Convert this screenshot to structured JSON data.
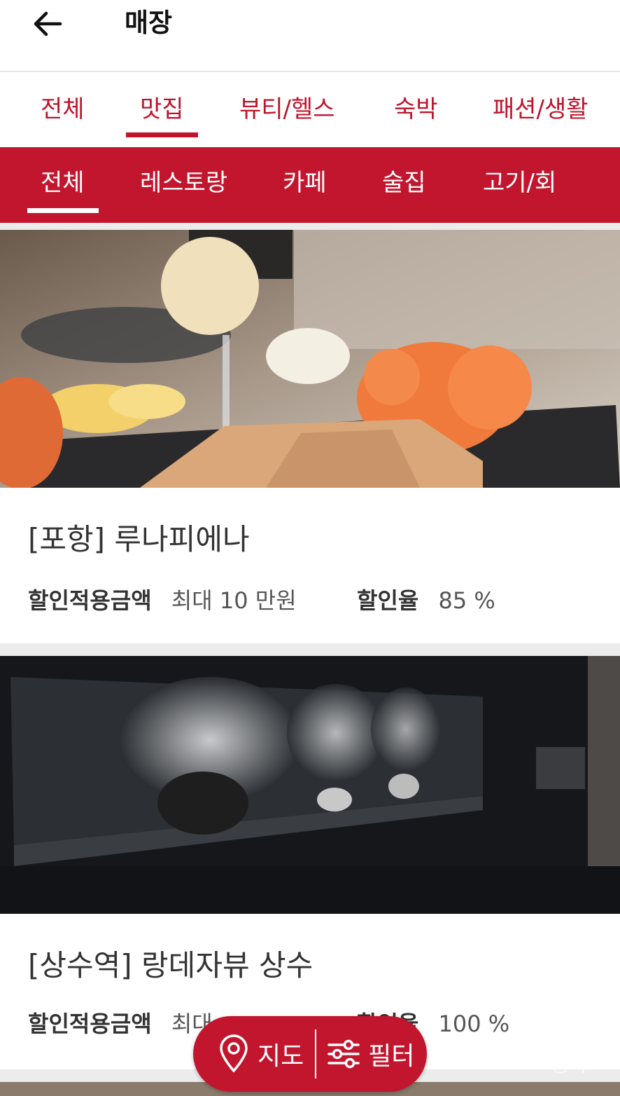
{
  "header": {
    "title": "매장"
  },
  "category_tabs": [
    {
      "label": "전체"
    },
    {
      "label": "맛집"
    },
    {
      "label": "뷰티/헬스"
    },
    {
      "label": "숙박"
    },
    {
      "label": "패션/생활"
    }
  ],
  "active_category": "맛집",
  "sub_tabs": [
    {
      "label": "전체"
    },
    {
      "label": "레스토랑"
    },
    {
      "label": "카페"
    },
    {
      "label": "술집"
    },
    {
      "label": "고기/회"
    }
  ],
  "active_sub_tab": "전체",
  "stores": [
    {
      "name": "[포항] 루나피에나",
      "discount_amount_label": "할인적용금액",
      "discount_amount_value": "최대 10 만원",
      "discount_rate_label": "할인율",
      "discount_rate_value": "85 %"
    },
    {
      "name": "[상수역] 랑데자뷰 상수",
      "discount_amount_label": "할인적용금액",
      "discount_amount_value": "최대",
      "discount_rate_label": "할인율",
      "discount_rate_value": "100 %"
    }
  ],
  "fab": {
    "map_label": "지도",
    "filter_label": "필터"
  },
  "watermark": "송하",
  "colors": {
    "brand": "#c2162e",
    "tab_text": "#c0142c"
  }
}
